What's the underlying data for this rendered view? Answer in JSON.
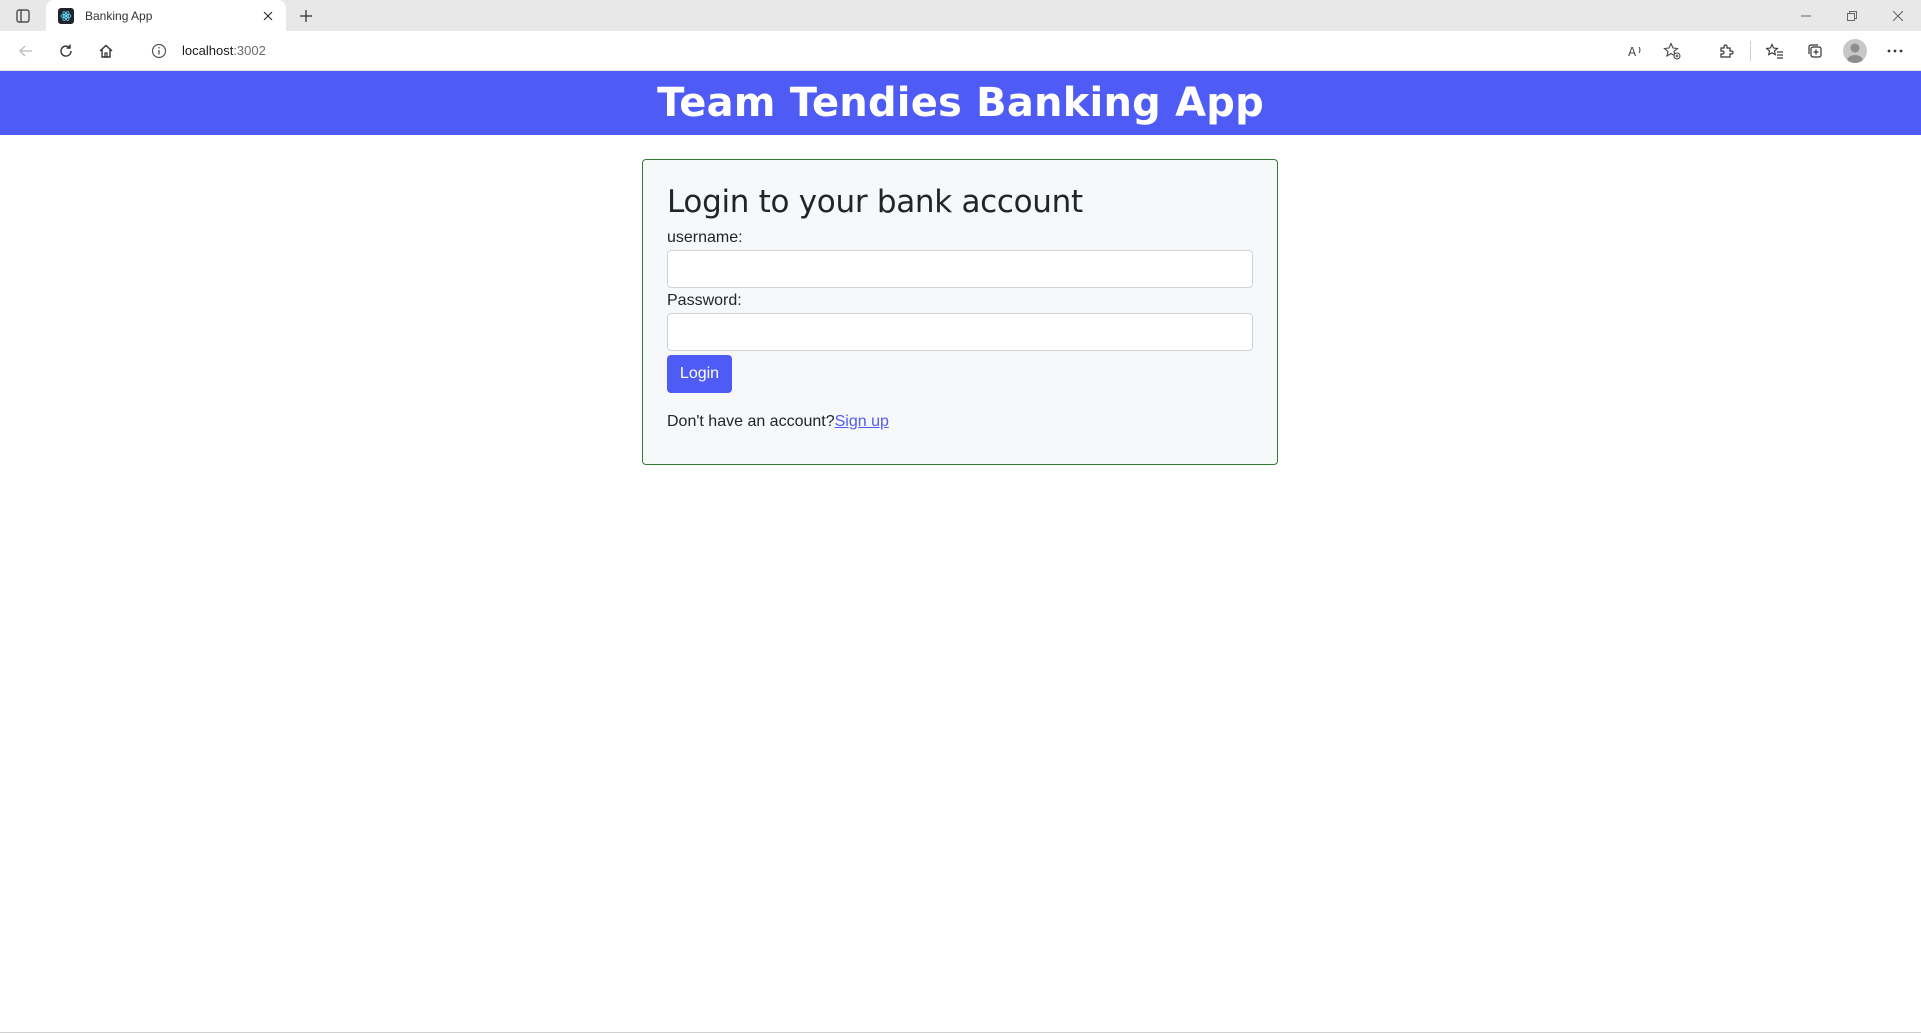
{
  "browser": {
    "tab": {
      "title": "Banking App",
      "favicon": "react-logo-icon"
    },
    "address": {
      "host": "localhost",
      "port": ":3002"
    },
    "icons": {
      "tab_actions": "tab-actions-icon",
      "close_tab": "close-icon",
      "new_tab": "plus-icon",
      "back": "back-arrow-icon",
      "refresh": "refresh-icon",
      "home": "home-icon",
      "info": "info-icon",
      "read_aloud": "read-aloud-icon",
      "add_favorite": "add-favorite-icon",
      "extensions": "extensions-icon",
      "favorites": "favorites-icon",
      "collections": "collections-icon",
      "profile": "profile-icon",
      "more": "more-icon",
      "minimize": "minimize-icon",
      "restore": "restore-icon",
      "close_window": "close-window-icon"
    }
  },
  "header": {
    "title": "Team Tendies Banking App"
  },
  "login": {
    "heading": "Login to your bank account",
    "username_label": "username:",
    "username_value": "",
    "password_label": "Password:",
    "password_value": "",
    "button_label": "Login",
    "signup_prompt": "Don't have an account?",
    "signup_link": "Sign up"
  },
  "colors": {
    "header_bg": "#4f5bf5",
    "button_bg": "#4f5bf5",
    "card_border": "#2e7d32",
    "card_bg": "#f7f8f9"
  }
}
